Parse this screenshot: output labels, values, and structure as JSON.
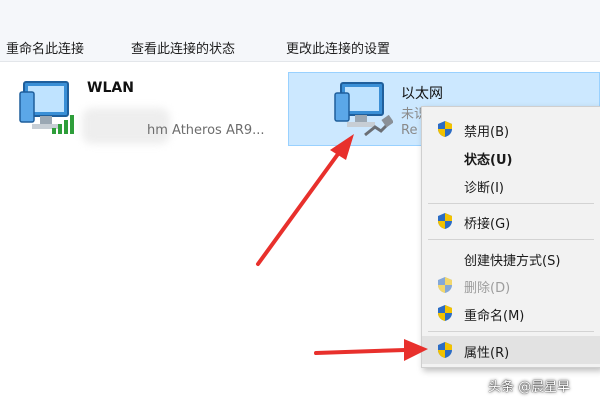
{
  "toolbar": {
    "rename": "重命名此连接",
    "view_status": "查看此连接的状态",
    "change_settings": "更改此连接的设置"
  },
  "adapters": {
    "wlan": {
      "name": "WLAN",
      "device_partial": "hm Atheros AR9...",
      "icon": "wifi-signal-icon"
    },
    "ethernet": {
      "name": "以太网",
      "status_partial": "未识别的网络",
      "device_partial": "Re",
      "icon": "ethernet-cable-icon"
    }
  },
  "context_menu": {
    "items": [
      {
        "label": "禁用(B)",
        "shield": true
      },
      {
        "label": "状态(U)",
        "shield": false,
        "bold": true
      },
      {
        "label": "诊断(I)",
        "shield": false
      },
      {
        "label": "桥接(G)",
        "shield": true
      },
      {
        "label": "创建快捷方式(S)",
        "shield": false
      },
      {
        "label": "删除(D)",
        "shield": true,
        "disabled": true
      },
      {
        "label": "重命名(M)",
        "shield": true
      },
      {
        "label": "属性(R)",
        "shield": true,
        "highlighted": true
      }
    ]
  },
  "watermark": "头条 @晨星早",
  "colors": {
    "selection": "#cce8ff",
    "arrow": "#e8302c",
    "menu_bg": "#f2f2f2"
  }
}
